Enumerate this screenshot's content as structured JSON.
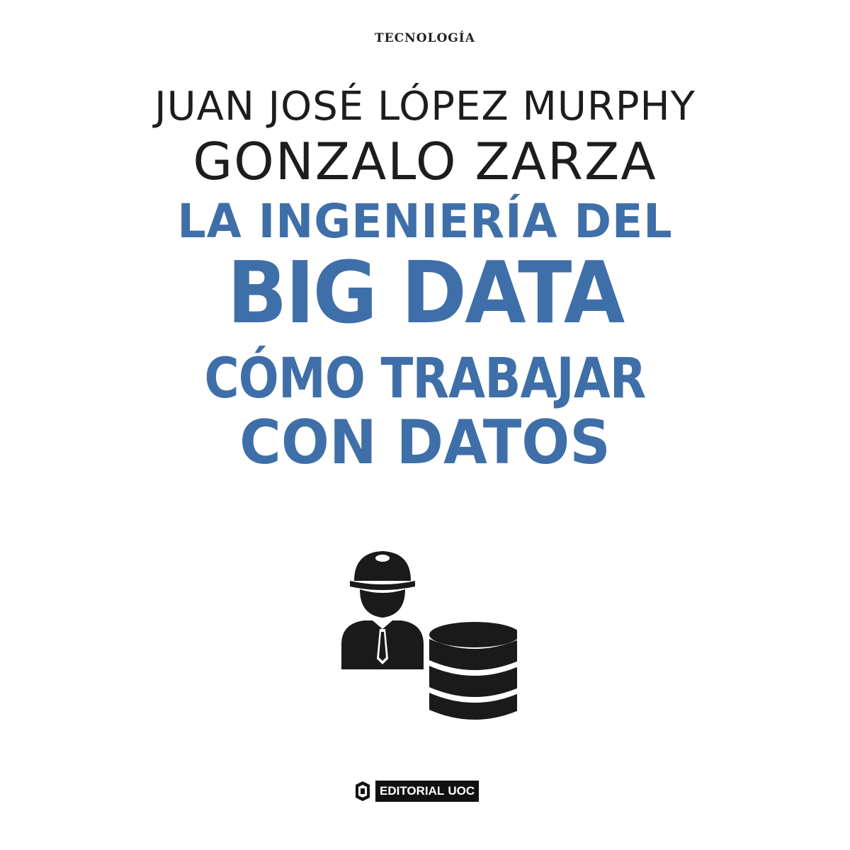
{
  "cover": {
    "series": "TECNOLOGÍA",
    "authors": [
      "JUAN JOSÉ LÓPEZ MURPHY",
      "GONZALO ZARZA"
    ],
    "title_lines": [
      "LA INGENIERÍA DEL",
      "BIG DATA",
      "CÓMO TRABAJAR",
      "CON DATOS"
    ],
    "illustration": {
      "icons": [
        "worker-helmet-icon",
        "database-icon"
      ]
    },
    "publisher": {
      "label": "EDITORIAL",
      "brand": "UOC",
      "icon": "uoc-logo-icon"
    },
    "colors": {
      "title": "#3f6fa8",
      "authors": "#1d1d1b",
      "icons": "#1a1a1a",
      "background": "#ffffff"
    }
  }
}
